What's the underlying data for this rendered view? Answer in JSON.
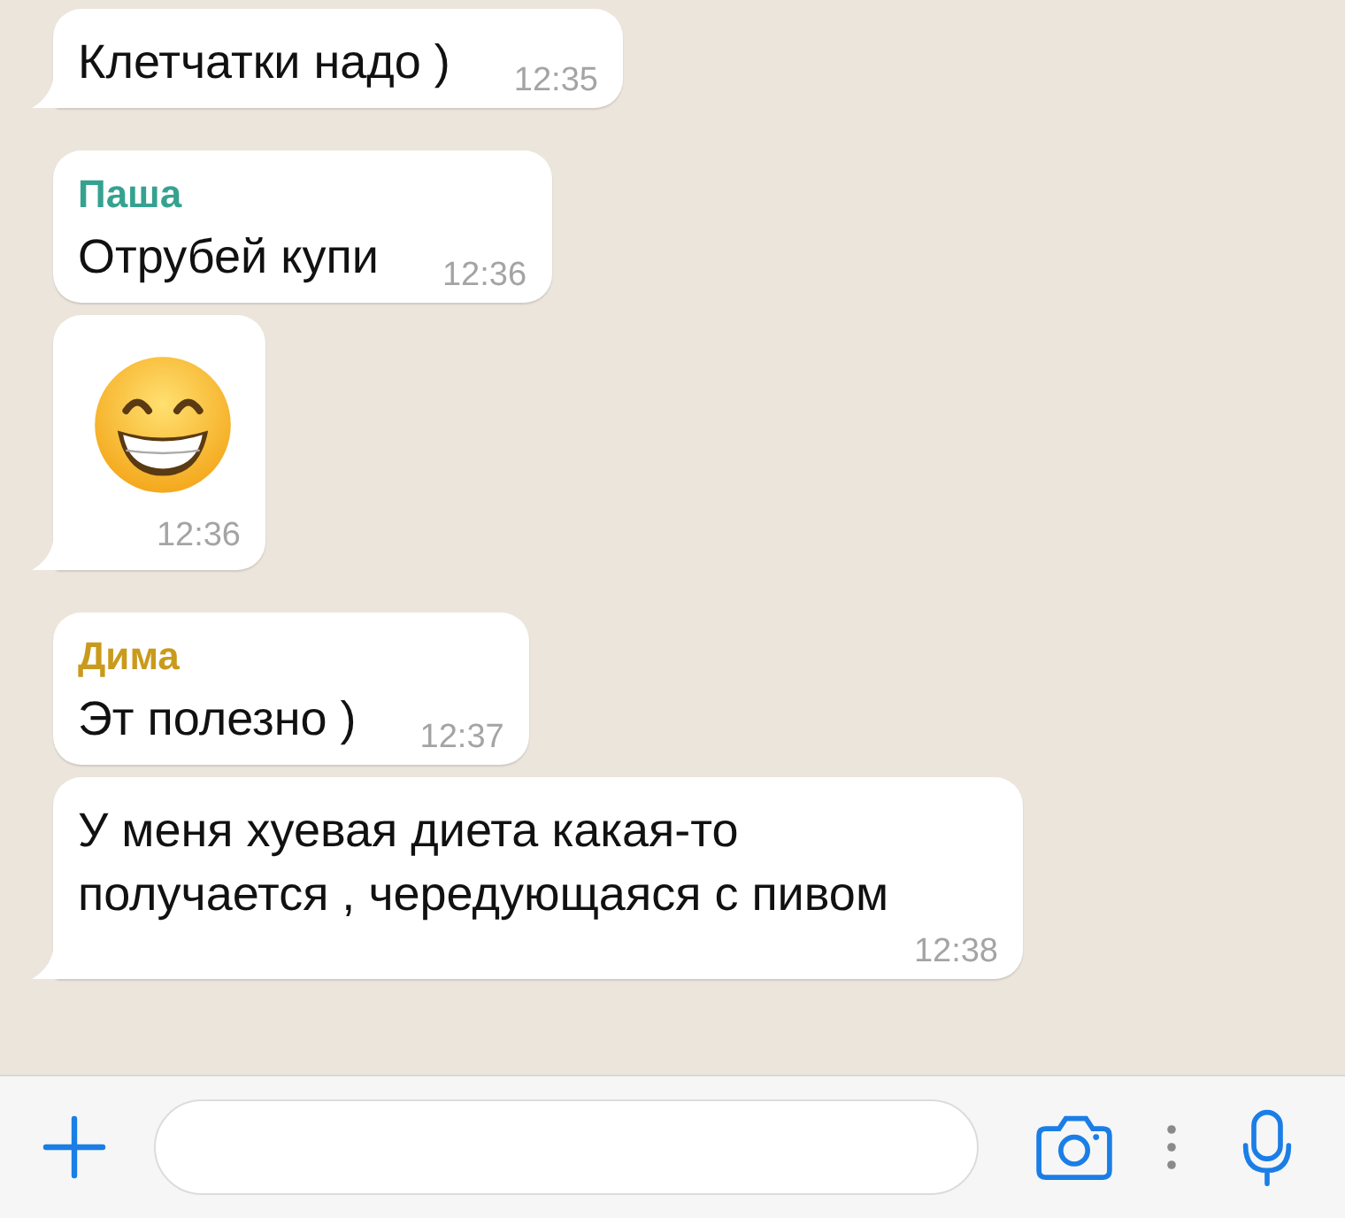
{
  "messages": [
    {
      "kind": "text",
      "text": "Клетчатки надо )",
      "time": "12:35"
    },
    {
      "kind": "text",
      "sender": "Паша",
      "color": "#35a290",
      "text": "Отрубей купи",
      "time": "12:36"
    },
    {
      "kind": "emoji",
      "time": "12:36"
    },
    {
      "kind": "text",
      "sender": "Дима",
      "color": "#c99a1c",
      "text": "Эт полезно )",
      "time": "12:37"
    },
    {
      "kind": "text",
      "text": "У меня хуевая диета какая-то получается , чередующаяся с пивом",
      "time": "12:38"
    }
  ]
}
